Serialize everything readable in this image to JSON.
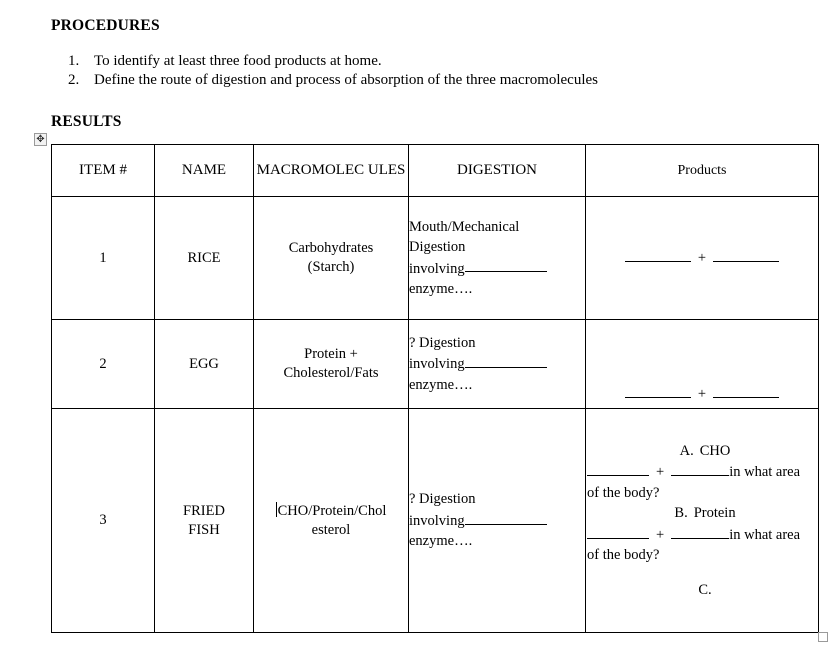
{
  "document": {
    "procedures_heading": "PROCEDURES",
    "results_heading": "RESULTS",
    "procedures": [
      {
        "number": "1.",
        "text": "To identify at least three food products at home."
      },
      {
        "number": "2.",
        "text": "Define the route of digestion and process of absorption of the three macromolecules"
      }
    ],
    "table": {
      "headers": {
        "item": "ITEM #",
        "name": "NAME",
        "macromolecules": "MACROMOLEC ULES",
        "digestion": "DIGESTION",
        "products": "Products"
      },
      "rows": [
        {
          "item": "1",
          "name": "RICE",
          "macromolecules_line1": "Carbohydrates",
          "macromolecules_line2": "(Starch)",
          "digestion_line1": "Mouth/Mechanical",
          "digestion_line2": "Digestion",
          "digestion_line3": "involving",
          "digestion_line4": "enzyme….",
          "products_plus": "+"
        },
        {
          "item": "2",
          "name": "EGG",
          "macromolecules_line1": "Protein +",
          "macromolecules_line2": "Cholesterol/Fats",
          "digestion_line1": "? Digestion",
          "digestion_line2": "involving",
          "digestion_line3": "enzyme….",
          "products_plus": "+"
        },
        {
          "item": "3",
          "name_line1": "FRIED",
          "name_line2": "FISH",
          "macromolecules_line1": "CHO/Protein/Chol",
          "macromolecules_line2": "esterol",
          "digestion_line1": "? Digestion",
          "digestion_line2": "involving",
          "digestion_line3": "enzyme….",
          "products": {
            "a_letter": "A.",
            "a_label": "CHO",
            "a_plus": "+",
            "a_suffix": "in what area",
            "a_question": "of the body?",
            "b_letter": "B.",
            "b_label": "Protein",
            "b_plus": "+",
            "b_suffix": "in what area",
            "b_question": "of the body?",
            "c_letter": "C."
          }
        }
      ]
    },
    "handles": {
      "move_handle_glyph": "✥",
      "move_handle_name": "table-move-handle",
      "resize_handle_name": "table-resize-handle"
    }
  }
}
